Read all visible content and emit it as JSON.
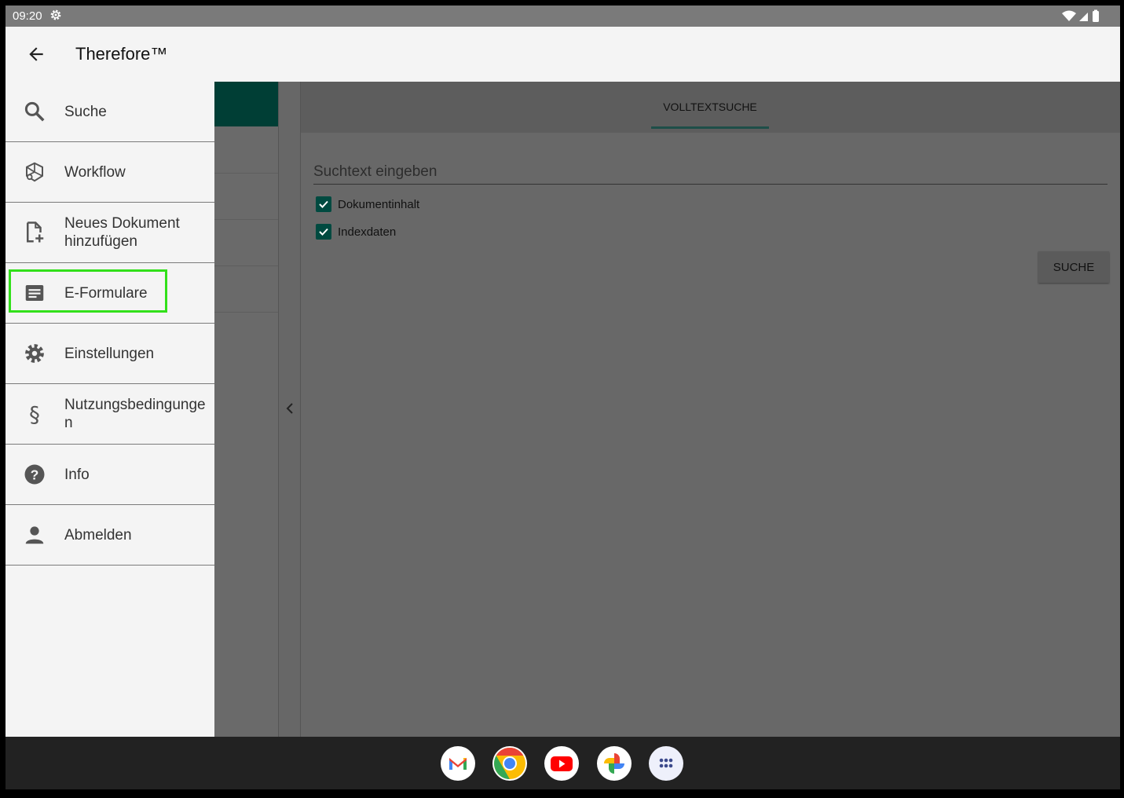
{
  "status": {
    "time": "09:20"
  },
  "appbar": {
    "title": "Therefore™"
  },
  "drawer": {
    "items": [
      {
        "label": "Suche"
      },
      {
        "label": "Workflow"
      },
      {
        "label": "Neues Dokument hinzufügen"
      },
      {
        "label": "E-Formulare"
      },
      {
        "label": "Einstellungen"
      },
      {
        "label": "Nutzungsbedingungen"
      },
      {
        "label": "Info"
      },
      {
        "label": "Abmelden"
      }
    ]
  },
  "tabs": {
    "volltextsuche": "VOLLTEXTSUCHE"
  },
  "search": {
    "placeholder": "Suchtext eingeben",
    "value": "",
    "checkboxes": [
      {
        "label": "Dokumentinhalt",
        "checked": true
      },
      {
        "label": "Indexdaten",
        "checked": true
      }
    ],
    "button": "SUCHE"
  },
  "dock": {
    "apps": [
      "gmail-icon",
      "chrome-icon",
      "youtube-icon",
      "photos-icon",
      "app-drawer-icon"
    ]
  },
  "colors": {
    "highlight": "#32e01a",
    "teal": "#004a40"
  }
}
